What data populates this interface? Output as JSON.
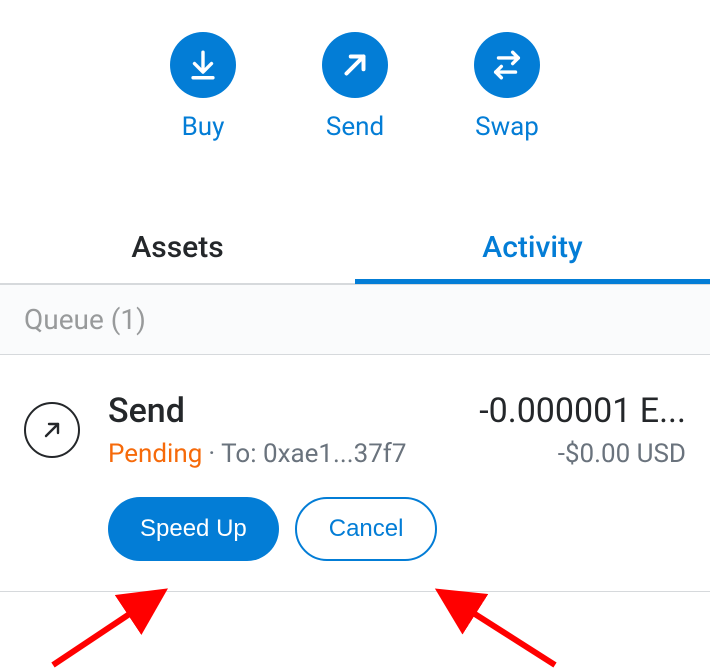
{
  "actions": {
    "buy": "Buy",
    "send": "Send",
    "swap": "Swap"
  },
  "tabs": {
    "assets": "Assets",
    "activity": "Activity"
  },
  "queue": {
    "label": "Queue (1)"
  },
  "transaction": {
    "title": "Send",
    "amount": "-0.000001 E...",
    "status": "Pending",
    "to_label": "To: 0xae1...37f7",
    "fiat": "-$0.00 USD",
    "speed_up": "Speed Up",
    "cancel": "Cancel"
  }
}
